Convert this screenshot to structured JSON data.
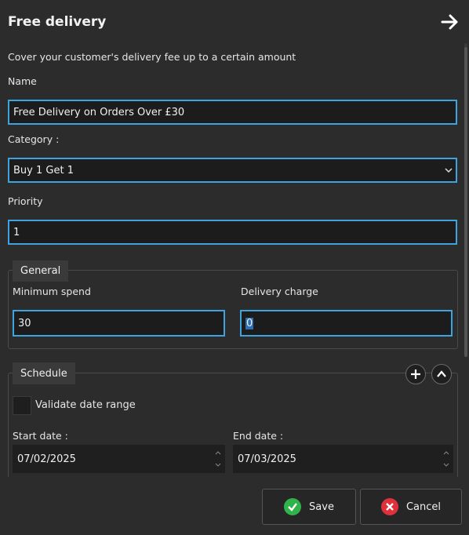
{
  "header": {
    "title": "Free delivery",
    "close_icon": "arrow-right-icon"
  },
  "intro": "Cover your customer's delivery fee up to a certain amount",
  "name": {
    "label": "Name",
    "value": "Free Delivery on Orders Over £30"
  },
  "category": {
    "label": "Category :",
    "value": "Buy 1 Get 1"
  },
  "priority": {
    "label": "Priority",
    "value": "1"
  },
  "general": {
    "legend": "General",
    "min_spend": {
      "label": "Minimum spend",
      "value": "30"
    },
    "delivery_charge": {
      "label": "Delivery charge",
      "value": "0"
    }
  },
  "schedule": {
    "legend": "Schedule",
    "validate_label": "Validate date range",
    "start": {
      "label": "Start date :",
      "value": "07/02/2025"
    },
    "end": {
      "label": "End date :",
      "value": "07/03/2025"
    }
  },
  "footer": {
    "save_label": "Save",
    "cancel_label": "Cancel"
  },
  "colors": {
    "accent": "#3ea4e0",
    "save": "#2fb34a",
    "cancel": "#e0313b",
    "background": "#2c2c2c"
  }
}
